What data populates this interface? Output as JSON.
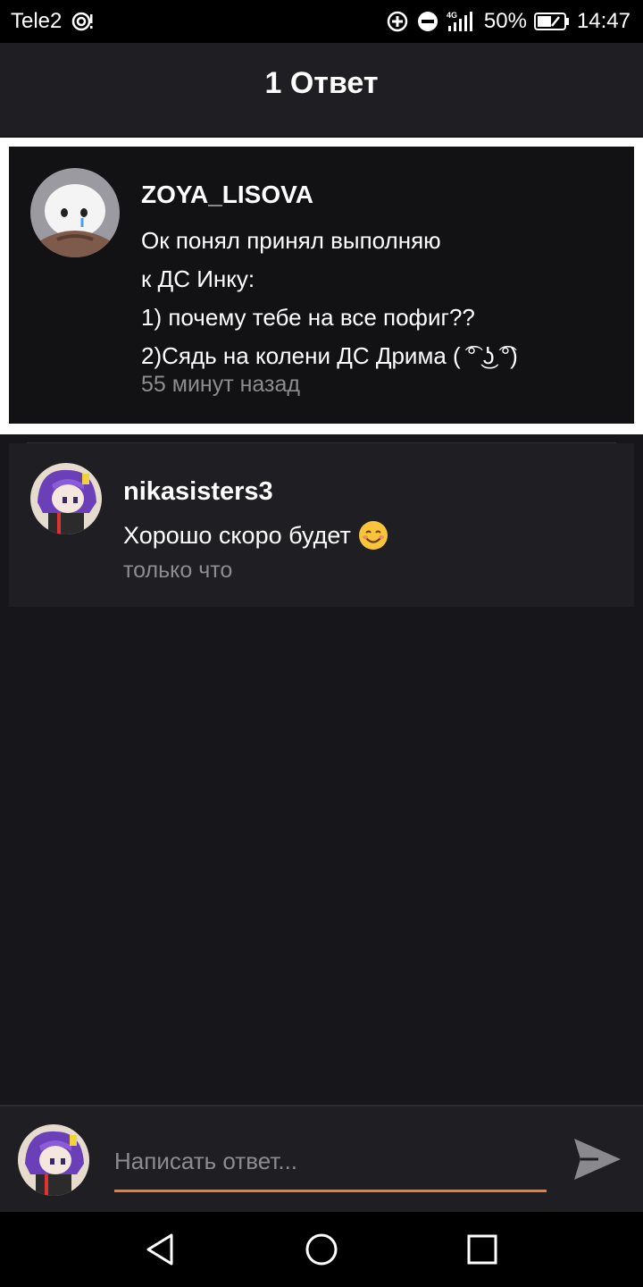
{
  "status_bar": {
    "carrier": "Tele2",
    "network_type": "4G",
    "battery": "50%",
    "time": "14:47"
  },
  "header": {
    "title": "1 Ответ"
  },
  "parent_comment": {
    "author": "ZOYA_LISOVA",
    "lines": [
      "Ок понял принял выполняю",
      "к ДС Инку:",
      "1) почему тебе на все пофиг??",
      "2)Сядь на колени ДС Дрима ( ͡° ͜ʖ ͡°)"
    ],
    "time": "55 минут назад"
  },
  "reply": {
    "author": "nikasisters3",
    "text": "Хорошо скоро будет",
    "emoji": "😊",
    "time": "только что"
  },
  "composer": {
    "placeholder": "Написать ответ..."
  },
  "colors": {
    "accent": "#f07a3a",
    "background": "#17161a",
    "card": "#1f1e22",
    "muted_text": "#8d8c91"
  }
}
